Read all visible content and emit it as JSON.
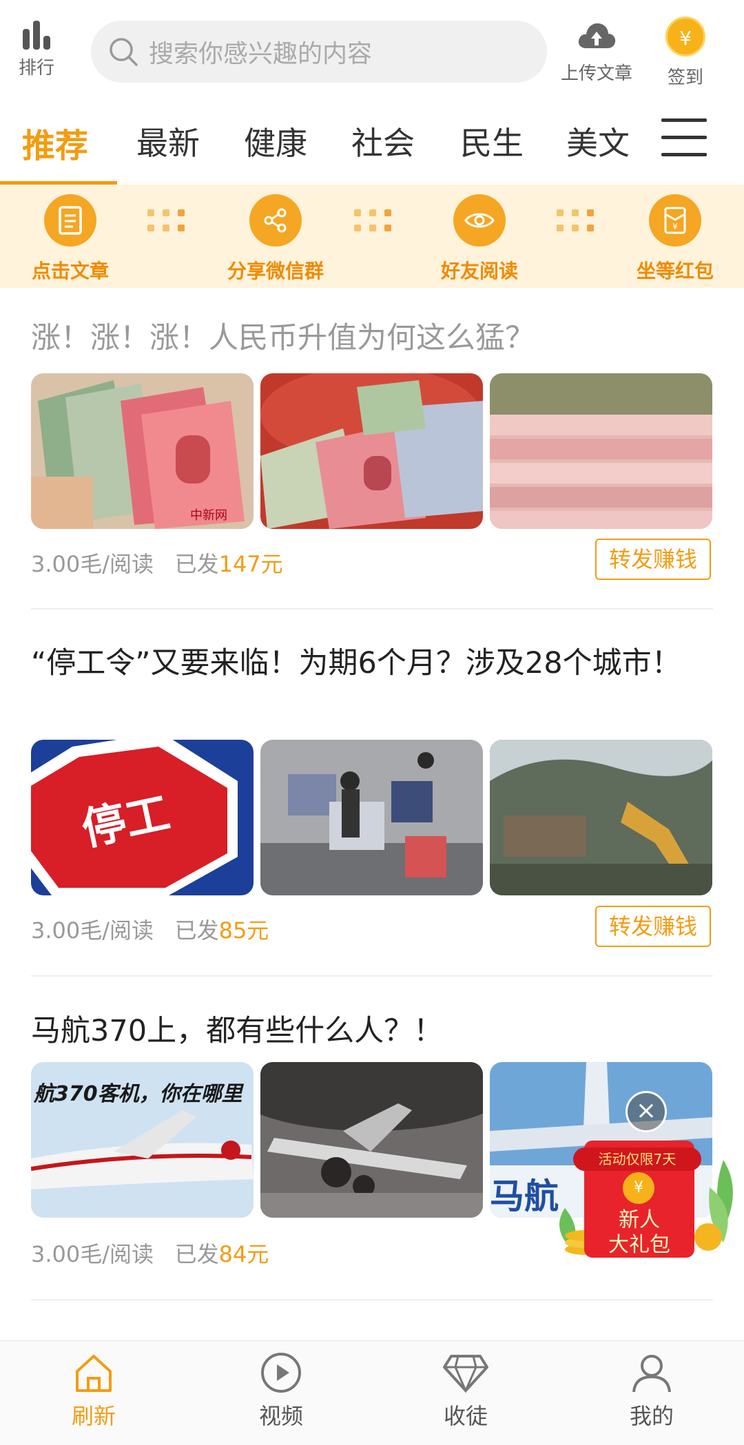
{
  "header": {
    "rank_label": "排行",
    "search_placeholder": "搜索你感兴趣的内容",
    "upload_label": "上传文章",
    "signin_label": "签到",
    "coin_symbol": "¥"
  },
  "tabs": [
    {
      "label": "推荐",
      "active": true
    },
    {
      "label": "最新",
      "active": false
    },
    {
      "label": "健康",
      "active": false
    },
    {
      "label": "社会",
      "active": false
    },
    {
      "label": "民生",
      "active": false
    },
    {
      "label": "美文",
      "active": false
    }
  ],
  "steps": [
    {
      "label": "点击文章",
      "icon": "document-icon"
    },
    {
      "label": "分享微信群",
      "icon": "share-icon"
    },
    {
      "label": "好友阅读",
      "icon": "eye-icon"
    },
    {
      "label": "坐等红包",
      "icon": "red-packet-icon"
    }
  ],
  "articles": [
    {
      "title": "涨！涨！涨！人民币升值为何这么猛？",
      "read": true,
      "price": "3.00毛/阅读",
      "paid_prefix": "已发",
      "paid_amount": "147元",
      "forward_label": "转发赚钱",
      "thumb_text": [
        "中新网",
        "",
        ""
      ]
    },
    {
      "title": "“停工令”又要来临！为期6个月？涉及28个城市！",
      "read": false,
      "price": "3.00毛/阅读",
      "paid_prefix": "已发",
      "paid_amount": "85元",
      "forward_label": "转发赚钱",
      "thumb_text": [
        "停工",
        "",
        ""
      ]
    },
    {
      "title": "马航370上，都有些什么人？！",
      "read": false,
      "price": "3.00毛/阅读",
      "paid_prefix": "已发",
      "paid_amount": "84元",
      "forward_label": "",
      "thumb_text": [
        "航370客机，你在哪里",
        "",
        "马航"
      ]
    }
  ],
  "packet": {
    "close": "×",
    "badge": "活动仅限7天",
    "coin": "¥",
    "line1": "新人",
    "line2": "大礼包"
  },
  "bottom_nav": [
    {
      "label": "刷新",
      "icon": "home-icon",
      "active": true
    },
    {
      "label": "视频",
      "icon": "play-icon",
      "active": false
    },
    {
      "label": "收徒",
      "icon": "diamond-icon",
      "active": false
    },
    {
      "label": "我的",
      "icon": "user-icon",
      "active": false
    }
  ],
  "colors": {
    "accent": "#f39c12",
    "banner_bg": "#fff3dc",
    "packet_red": "#e8232b"
  }
}
